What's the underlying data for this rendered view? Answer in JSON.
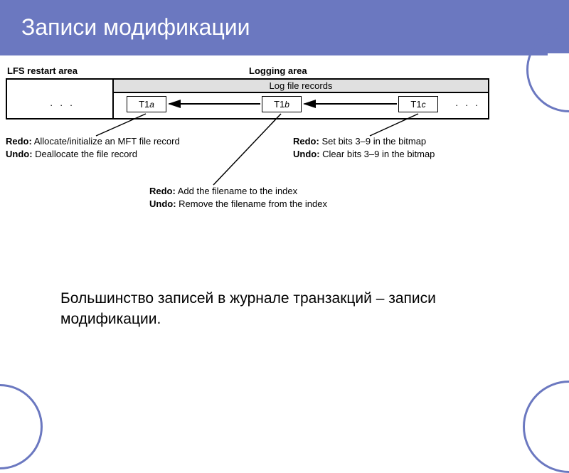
{
  "title": "Записи модификации",
  "labels": {
    "lfs_restart": "LFS restart area",
    "logging_area": "Logging area",
    "logfile_records": "Log file records"
  },
  "records": {
    "a": {
      "t": "T1",
      "s": "a"
    },
    "b": {
      "t": "T1",
      "s": "b"
    },
    "c": {
      "t": "T1",
      "s": "c"
    }
  },
  "anno_left": {
    "redo_label": "Redo:",
    "redo_text": " Allocate/initialize an MFT file record",
    "undo_label": "Undo:",
    "undo_text": " Deallocate the file record"
  },
  "anno_mid": {
    "redo_label": "Redo:",
    "redo_text": " Add the filename to the index",
    "undo_label": "Undo:",
    "undo_text": " Remove the filename from the index"
  },
  "anno_right": {
    "redo_label": "Redo:",
    "redo_text": " Set bits 3–9 in the bitmap",
    "undo_label": "Undo:",
    "undo_text": " Clear bits 3–9 in the bitmap"
  },
  "body": "Большинство записей в журнале транзакций – записи модификации.",
  "ellipsis": "· · ·"
}
